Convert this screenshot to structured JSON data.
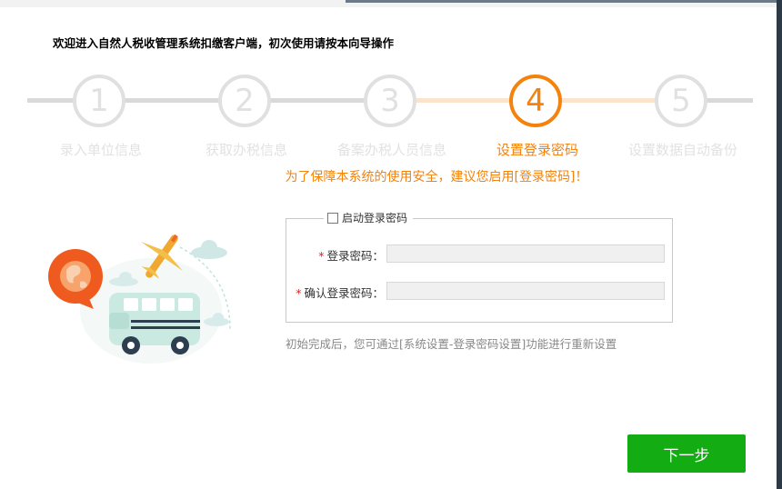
{
  "header": {
    "title": "欢迎进入自然人税收管理系统扣缴客户端，初次使用请按本向导操作"
  },
  "steps": [
    {
      "number": "1",
      "label": "录入单位信息",
      "state": "inactive"
    },
    {
      "number": "2",
      "label": "获取办税信息",
      "state": "inactive"
    },
    {
      "number": "3",
      "label": "备案办税人员信息",
      "state": "inactive"
    },
    {
      "number": "4",
      "label": "设置登录密码",
      "state": "active"
    },
    {
      "number": "5",
      "label": "设置数据自动备份",
      "state": "inactive"
    }
  ],
  "notice": "为了保障本系统的使用安全，建议您启用[登录密码]！",
  "password_group": {
    "checkbox_label": "启动登录密码",
    "checked": false,
    "fields": [
      {
        "required_mark": "*",
        "label": "登录密码：",
        "value": ""
      },
      {
        "required_mark": "*",
        "label": "确认登录密码：",
        "value": ""
      }
    ]
  },
  "hint": "初始完成后，您可通过[系统设置-登录密码设置]功能进行重新设置",
  "footer": {
    "next_label": "下一步"
  },
  "colors": {
    "accent": "#f4820b",
    "inactive": "#e0e0e0",
    "primary_button": "#13ad13",
    "required": "#e02020"
  },
  "illustration": {
    "icons": [
      "globe-chat-icon",
      "airplane-icon",
      "bus-icon",
      "cloud-icon"
    ]
  }
}
